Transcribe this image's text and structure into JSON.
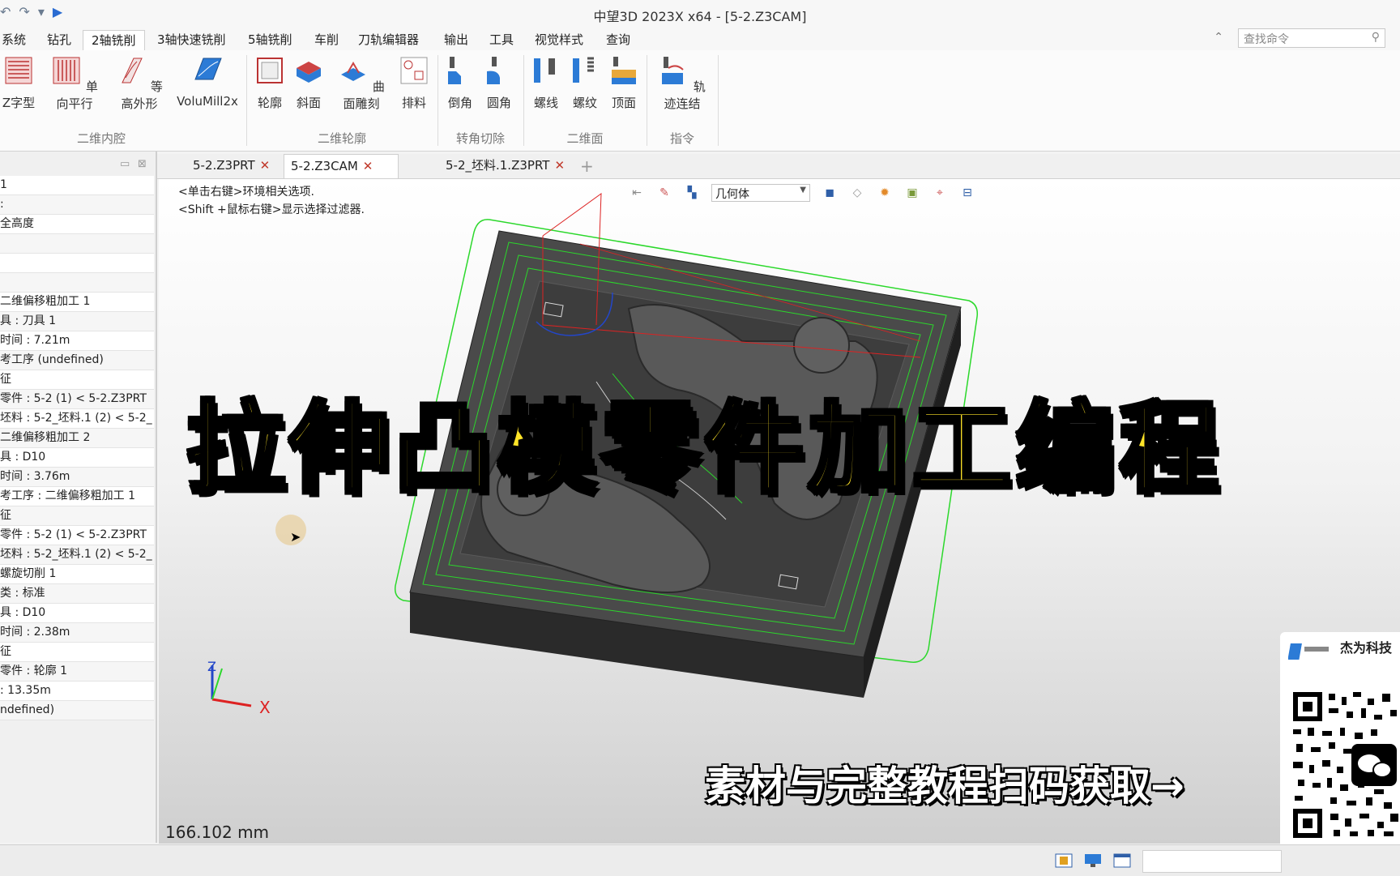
{
  "window": {
    "title": "中望3D 2023X x64 - [5-2.Z3CAM]"
  },
  "menu": {
    "tabs": [
      "系统",
      "钻孔",
      "2轴铣削",
      "3轴快速铣削",
      "5轴铣削",
      "车削",
      "刀轨编辑器",
      "输出",
      "工具",
      "视觉样式",
      "查询"
    ],
    "active_index": 2,
    "search_placeholder": "查找命令"
  },
  "ribbon": {
    "buttons": [
      "Z字型",
      "单向平行",
      "等高外形",
      "VoluMill2x",
      "轮廓",
      "斜面",
      "曲面雕刻",
      "排料",
      "倒角",
      "圆角",
      "螺线",
      "螺纹",
      "顶面",
      "轨迹连结"
    ],
    "groups": [
      "二维内腔",
      "二维轮廓",
      "转角切除",
      "二维面",
      "指令"
    ]
  },
  "doc_tabs": [
    "5-2.Z3PRT",
    "5-2.Z3CAM",
    "5-2_坯料.1.Z3PRT"
  ],
  "active_doc": 1,
  "tree_rows": [
    "1",
    ":",
    "全高度",
    "",
    "",
    "",
    "二维偏移粗加工 1",
    "具 : 刀具 1",
    "时间 : 7.21m",
    "考工序 (undefined)",
    "征",
    "零件 : 5-2 (1) < 5-2.Z3PRT",
    "坯料 : 5-2_坯料.1 (2) < 5-2_",
    "二维偏移粗加工 2",
    "具 : D10",
    "时间 : 3.76m",
    "考工序 : 二维偏移粗加工 1",
    "征",
    "零件 : 5-2 (1) < 5-2.Z3PRT",
    "坯料 : 5-2_坯料.1 (2) < 5-2_",
    "螺旋切削 1",
    "类 : 标准",
    "具 : D10",
    "时间 : 2.38m",
    "征",
    "零件 : 轮廓 1",
    ": 13.35m",
    "ndefined)"
  ],
  "viewport": {
    "hint1": "<单击右键>环境相关选项.",
    "hint2": "<Shift +鼠标右键>显示选择过滤器.",
    "filter_value": "几何体",
    "measure": "166.102 mm",
    "axis_x": "X",
    "axis_z": "Z"
  },
  "overlay": {
    "banner": "拉伸凸模零件加工编程",
    "cta": "素材与完整教程扫码获取→",
    "brand": "杰为科技"
  }
}
